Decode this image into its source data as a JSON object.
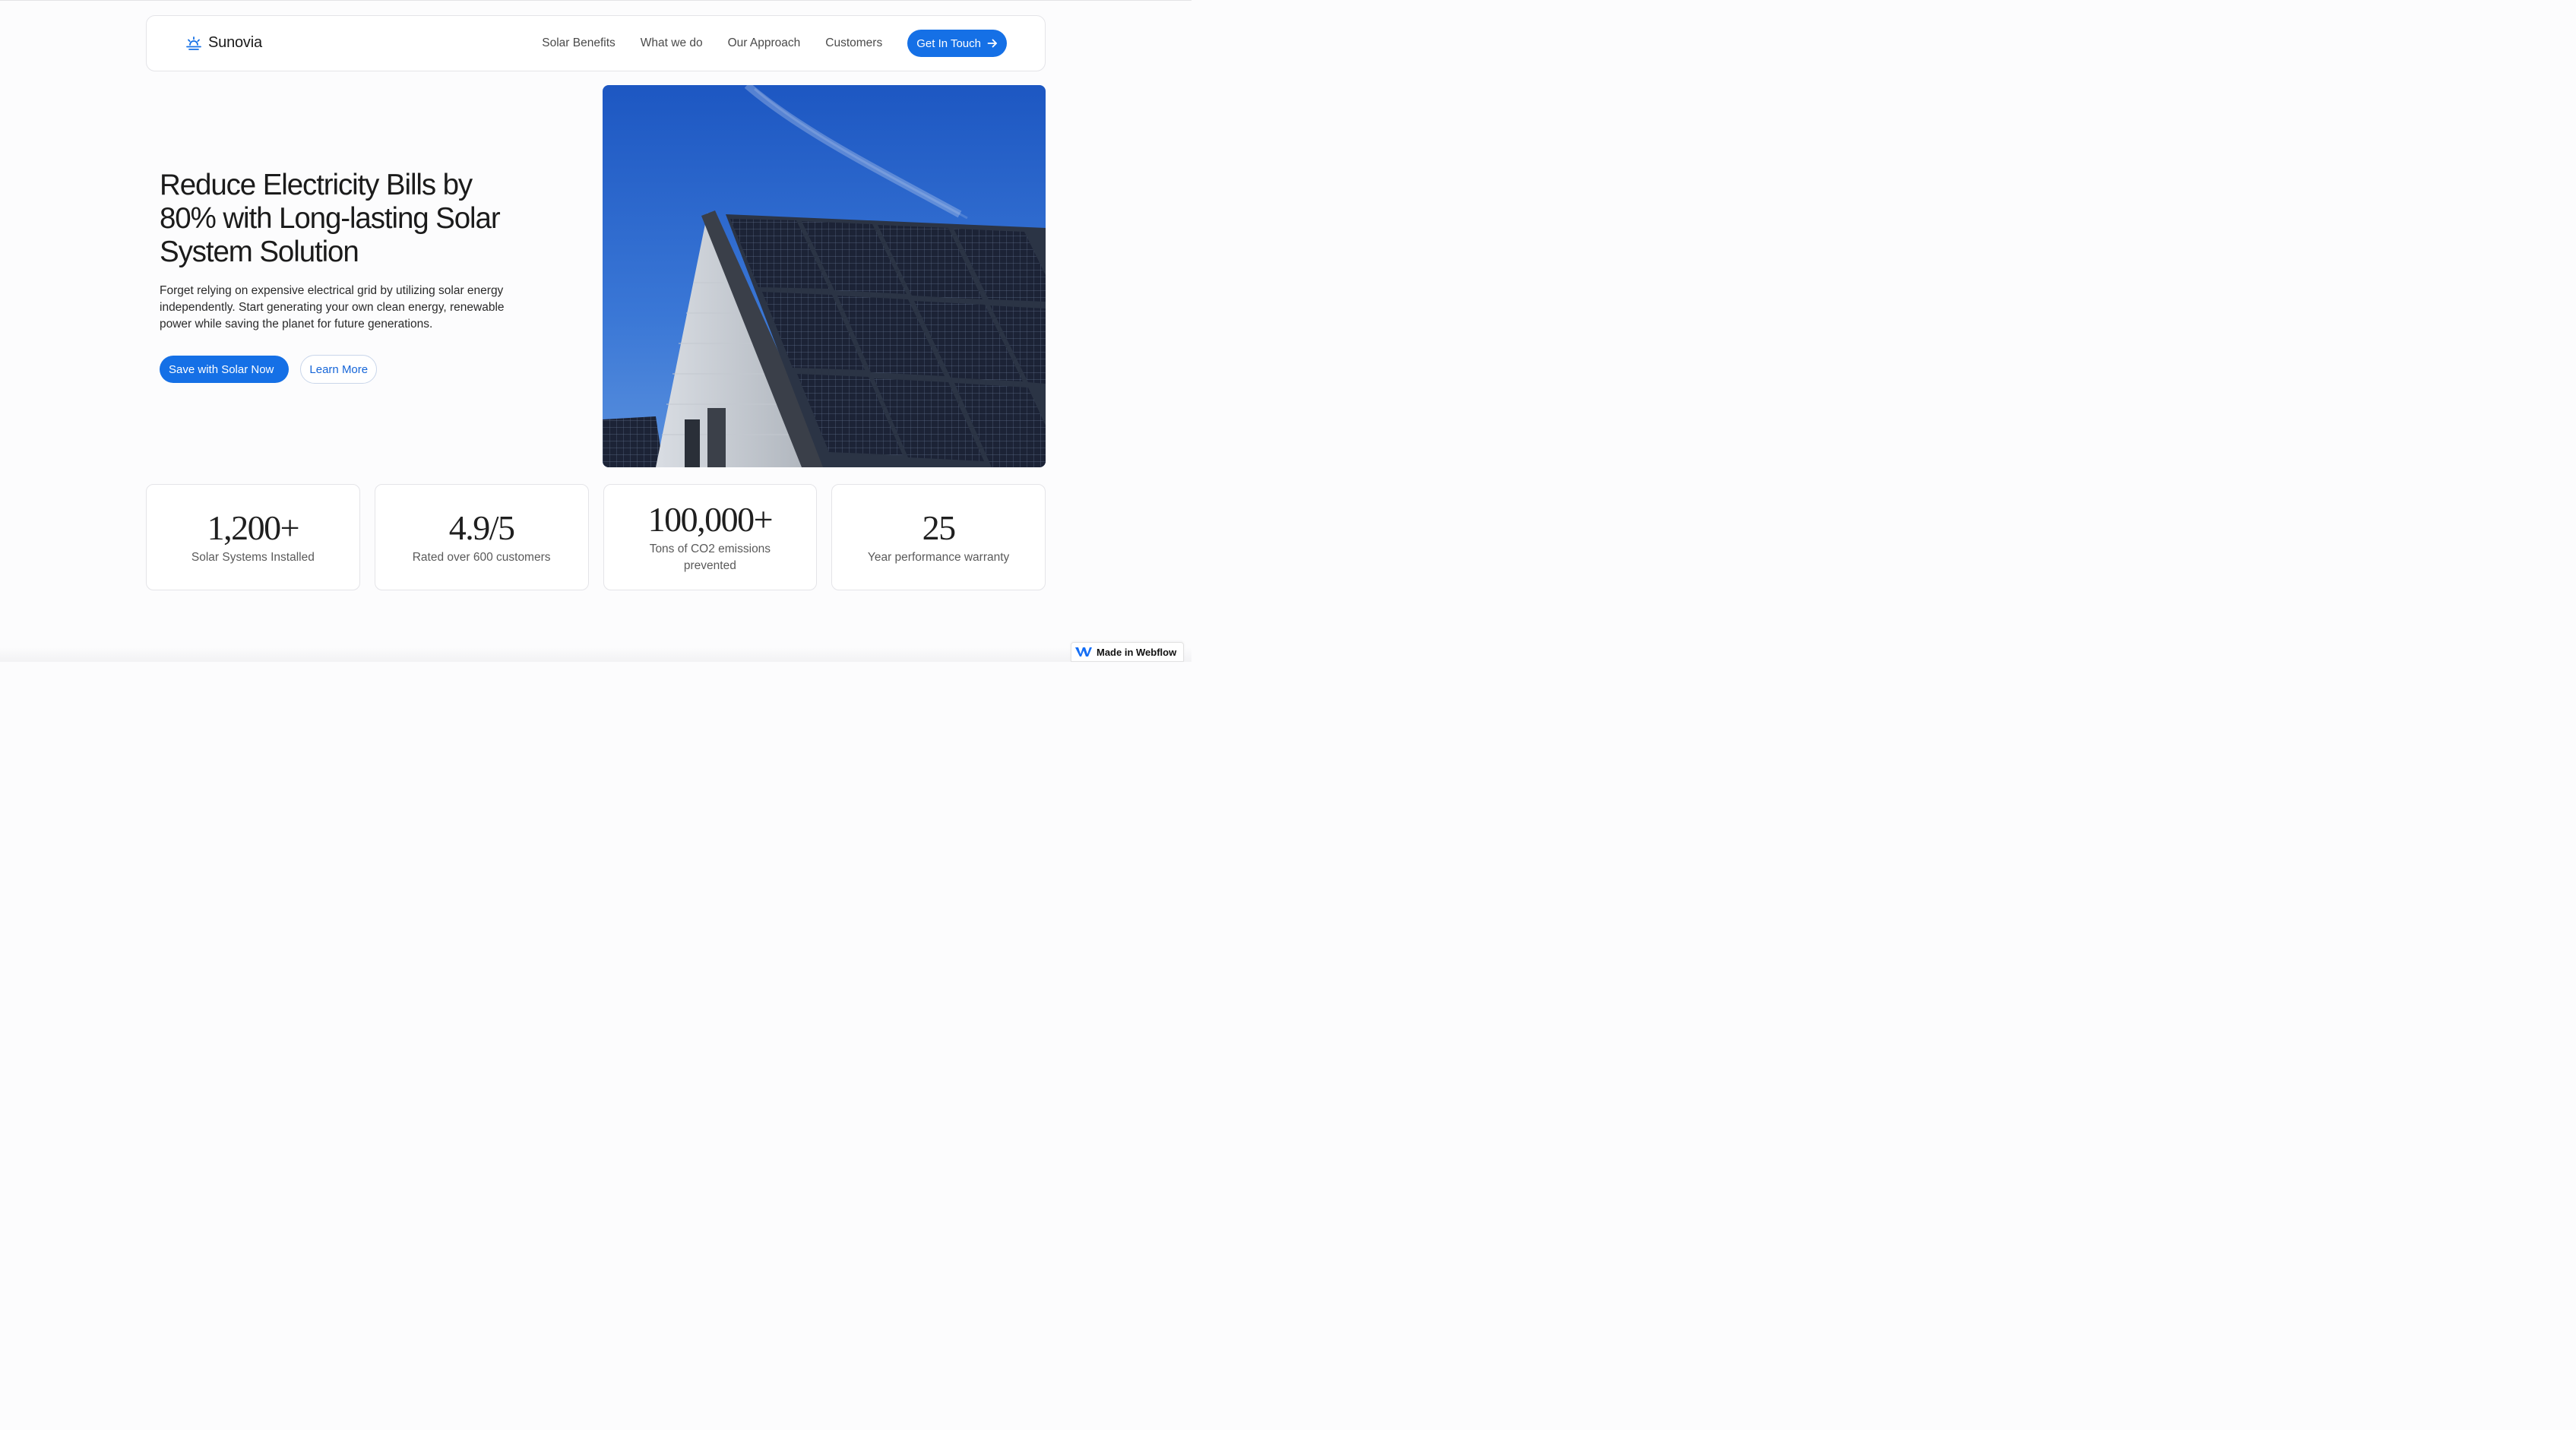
{
  "nav": {
    "logo_text": "Sunovia",
    "links": [
      "Solar Benefits",
      "What we do",
      "Our Approach",
      "Customers"
    ],
    "cta_label": "Get In Touch"
  },
  "hero": {
    "headline": "Reduce Electricity Bills by 80% with Long-lasting Solar System Solution",
    "subtext": "Forget relying on expensive electrical grid by utilizing solar energy independently. Start generating your own clean energy, renewable power while saving the planet for future generations.",
    "primary_button": "Save with Solar Now",
    "secondary_button": "Learn More"
  },
  "stats": [
    {
      "value": "1,200+",
      "label": "Solar Systems Installed"
    },
    {
      "value": "4.9/5",
      "label": "Rated over 600 customers"
    },
    {
      "value": "100,000+",
      "label": "Tons of CO2 emissions prevented"
    },
    {
      "value": "25",
      "label": "Year performance warranty"
    }
  ],
  "badge": {
    "label": "Made in Webflow"
  },
  "colors": {
    "accent": "#1570e6",
    "sky": "#2f6ad0",
    "panel": "#1b2233"
  }
}
